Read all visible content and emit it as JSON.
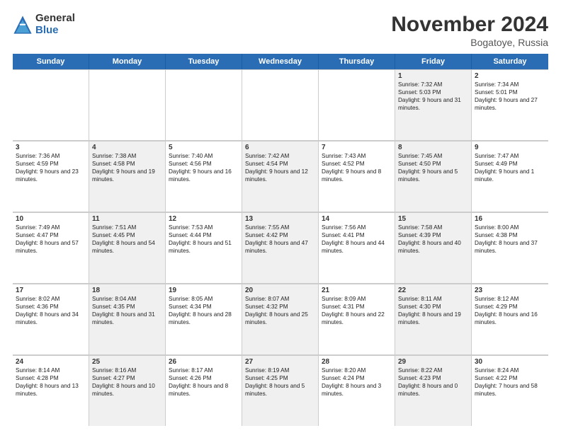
{
  "logo": {
    "general": "General",
    "blue": "Blue"
  },
  "title": "November 2024",
  "location": "Bogatoye, Russia",
  "days_of_week": [
    "Sunday",
    "Monday",
    "Tuesday",
    "Wednesday",
    "Thursday",
    "Friday",
    "Saturday"
  ],
  "weeks": [
    [
      {
        "day": "",
        "info": "",
        "shaded": false,
        "empty": true
      },
      {
        "day": "",
        "info": "",
        "shaded": false,
        "empty": true
      },
      {
        "day": "",
        "info": "",
        "shaded": false,
        "empty": true
      },
      {
        "day": "",
        "info": "",
        "shaded": false,
        "empty": true
      },
      {
        "day": "",
        "info": "",
        "shaded": false,
        "empty": true
      },
      {
        "day": "1",
        "info": "Sunrise: 7:32 AM\nSunset: 5:03 PM\nDaylight: 9 hours and 31 minutes.",
        "shaded": true
      },
      {
        "day": "2",
        "info": "Sunrise: 7:34 AM\nSunset: 5:01 PM\nDaylight: 9 hours and 27 minutes.",
        "shaded": false
      }
    ],
    [
      {
        "day": "3",
        "info": "Sunrise: 7:36 AM\nSunset: 4:59 PM\nDaylight: 9 hours and 23 minutes.",
        "shaded": false
      },
      {
        "day": "4",
        "info": "Sunrise: 7:38 AM\nSunset: 4:58 PM\nDaylight: 9 hours and 19 minutes.",
        "shaded": true
      },
      {
        "day": "5",
        "info": "Sunrise: 7:40 AM\nSunset: 4:56 PM\nDaylight: 9 hours and 16 minutes.",
        "shaded": false
      },
      {
        "day": "6",
        "info": "Sunrise: 7:42 AM\nSunset: 4:54 PM\nDaylight: 9 hours and 12 minutes.",
        "shaded": true
      },
      {
        "day": "7",
        "info": "Sunrise: 7:43 AM\nSunset: 4:52 PM\nDaylight: 9 hours and 8 minutes.",
        "shaded": false
      },
      {
        "day": "8",
        "info": "Sunrise: 7:45 AM\nSunset: 4:50 PM\nDaylight: 9 hours and 5 minutes.",
        "shaded": true
      },
      {
        "day": "9",
        "info": "Sunrise: 7:47 AM\nSunset: 4:49 PM\nDaylight: 9 hours and 1 minute.",
        "shaded": false
      }
    ],
    [
      {
        "day": "10",
        "info": "Sunrise: 7:49 AM\nSunset: 4:47 PM\nDaylight: 8 hours and 57 minutes.",
        "shaded": false
      },
      {
        "day": "11",
        "info": "Sunrise: 7:51 AM\nSunset: 4:45 PM\nDaylight: 8 hours and 54 minutes.",
        "shaded": true
      },
      {
        "day": "12",
        "info": "Sunrise: 7:53 AM\nSunset: 4:44 PM\nDaylight: 8 hours and 51 minutes.",
        "shaded": false
      },
      {
        "day": "13",
        "info": "Sunrise: 7:55 AM\nSunset: 4:42 PM\nDaylight: 8 hours and 47 minutes.",
        "shaded": true
      },
      {
        "day": "14",
        "info": "Sunrise: 7:56 AM\nSunset: 4:41 PM\nDaylight: 8 hours and 44 minutes.",
        "shaded": false
      },
      {
        "day": "15",
        "info": "Sunrise: 7:58 AM\nSunset: 4:39 PM\nDaylight: 8 hours and 40 minutes.",
        "shaded": true
      },
      {
        "day": "16",
        "info": "Sunrise: 8:00 AM\nSunset: 4:38 PM\nDaylight: 8 hours and 37 minutes.",
        "shaded": false
      }
    ],
    [
      {
        "day": "17",
        "info": "Sunrise: 8:02 AM\nSunset: 4:36 PM\nDaylight: 8 hours and 34 minutes.",
        "shaded": false
      },
      {
        "day": "18",
        "info": "Sunrise: 8:04 AM\nSunset: 4:35 PM\nDaylight: 8 hours and 31 minutes.",
        "shaded": true
      },
      {
        "day": "19",
        "info": "Sunrise: 8:05 AM\nSunset: 4:34 PM\nDaylight: 8 hours and 28 minutes.",
        "shaded": false
      },
      {
        "day": "20",
        "info": "Sunrise: 8:07 AM\nSunset: 4:32 PM\nDaylight: 8 hours and 25 minutes.",
        "shaded": true
      },
      {
        "day": "21",
        "info": "Sunrise: 8:09 AM\nSunset: 4:31 PM\nDaylight: 8 hours and 22 minutes.",
        "shaded": false
      },
      {
        "day": "22",
        "info": "Sunrise: 8:11 AM\nSunset: 4:30 PM\nDaylight: 8 hours and 19 minutes.",
        "shaded": true
      },
      {
        "day": "23",
        "info": "Sunrise: 8:12 AM\nSunset: 4:29 PM\nDaylight: 8 hours and 16 minutes.",
        "shaded": false
      }
    ],
    [
      {
        "day": "24",
        "info": "Sunrise: 8:14 AM\nSunset: 4:28 PM\nDaylight: 8 hours and 13 minutes.",
        "shaded": false
      },
      {
        "day": "25",
        "info": "Sunrise: 8:16 AM\nSunset: 4:27 PM\nDaylight: 8 hours and 10 minutes.",
        "shaded": true
      },
      {
        "day": "26",
        "info": "Sunrise: 8:17 AM\nSunset: 4:26 PM\nDaylight: 8 hours and 8 minutes.",
        "shaded": false
      },
      {
        "day": "27",
        "info": "Sunrise: 8:19 AM\nSunset: 4:25 PM\nDaylight: 8 hours and 5 minutes.",
        "shaded": true
      },
      {
        "day": "28",
        "info": "Sunrise: 8:20 AM\nSunset: 4:24 PM\nDaylight: 8 hours and 3 minutes.",
        "shaded": false
      },
      {
        "day": "29",
        "info": "Sunrise: 8:22 AM\nSunset: 4:23 PM\nDaylight: 8 hours and 0 minutes.",
        "shaded": true
      },
      {
        "day": "30",
        "info": "Sunrise: 8:24 AM\nSunset: 4:22 PM\nDaylight: 7 hours and 58 minutes.",
        "shaded": false
      }
    ]
  ]
}
